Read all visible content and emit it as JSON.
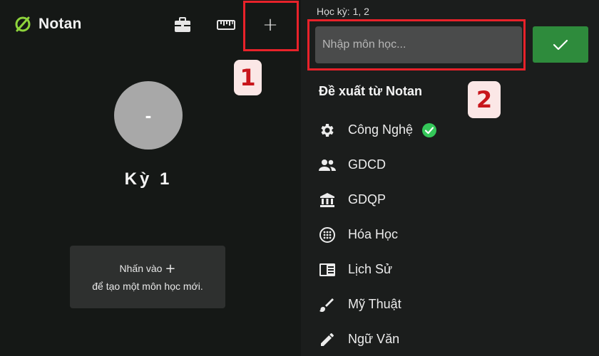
{
  "app": {
    "name": "Notan"
  },
  "left": {
    "avatar_text": "-",
    "semester_title": "Kỳ 1",
    "hint_line1": "Nhấn vào",
    "hint_plus": "+",
    "hint_line2": "để tạo một môn học mới."
  },
  "toolbar": {
    "add_symbol": "+"
  },
  "annotations": {
    "badge1": "1",
    "badge2": "2"
  },
  "right": {
    "term_label": "Học kỳ: 1, 2",
    "search_placeholder": "Nhập môn học...",
    "section_title": "Đề xuất từ Notan",
    "suggestions": [
      {
        "label": "Công Nghệ",
        "icon": "gear-icon",
        "selected": true
      },
      {
        "label": "GDCD",
        "icon": "people-icon"
      },
      {
        "label": "GDQP",
        "icon": "institution-icon"
      },
      {
        "label": "Hóa Học",
        "icon": "dots-circle-icon"
      },
      {
        "label": "Lịch Sử",
        "icon": "book-icon"
      },
      {
        "label": "Mỹ Thuật",
        "icon": "brush-icon"
      },
      {
        "label": "Ngữ Văn",
        "icon": "pencil-icon"
      }
    ]
  },
  "colors": {
    "accent_green": "#2e8b3c",
    "check_green": "#34c759",
    "highlight_red": "#e8222a"
  }
}
